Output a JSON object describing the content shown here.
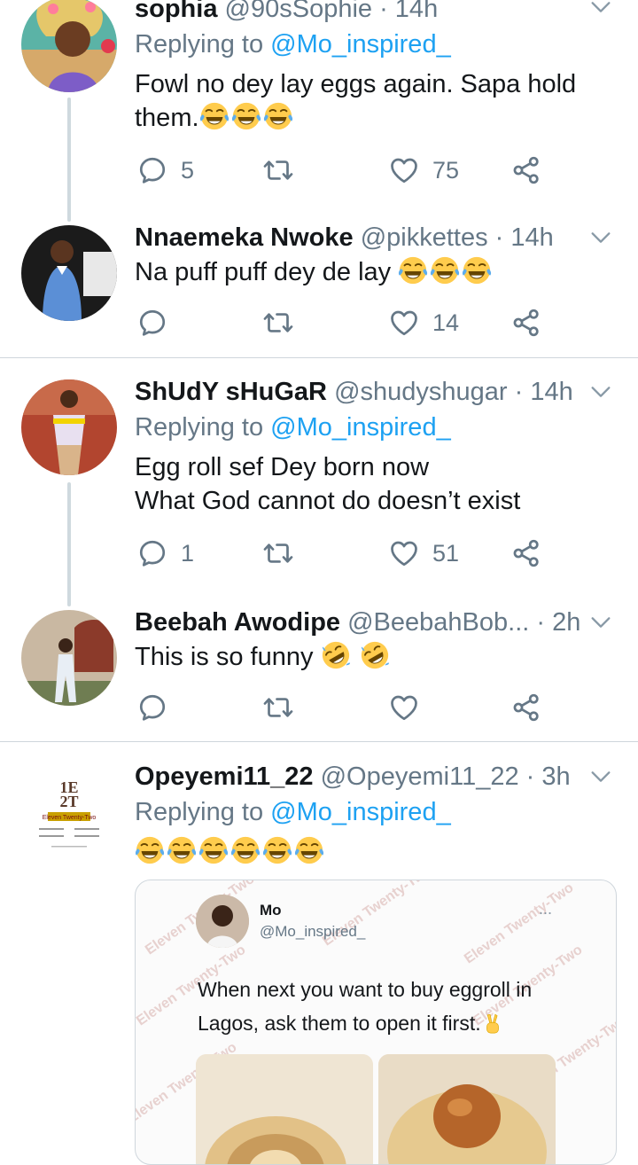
{
  "tweets": [
    {
      "name": "sophia",
      "handle": "@90sSophie",
      "time": "· 14h",
      "replying_prefix": "Replying to ",
      "replying_to": "@Mo_inspired_",
      "text_line1": "Fowl no dey lay eggs again. Sapa hold",
      "text_line2": "them.",
      "replies": "5",
      "likes": "75"
    },
    {
      "name": "Nnaemeka Nwoke",
      "handle": "@pikkettes",
      "time": "· 14h",
      "text_line1": "Na puff puff dey de lay",
      "replies": "",
      "likes": "14"
    },
    {
      "name": "ShUdY sHuGaR",
      "handle": "@shudyshugar",
      "time": "· 14h",
      "replying_prefix": "Replying to ",
      "replying_to": "@Mo_inspired_",
      "text_line1": "Egg roll sef Dey born now",
      "text_line2": "What God cannot do doesn’t exist",
      "replies": "1",
      "likes": "51"
    },
    {
      "name": "Beebah Awodipe",
      "handle": "@BeebahBob...",
      "time": "· 2h",
      "text_line1": "This is so funny",
      "replies": "",
      "likes": ""
    },
    {
      "name": "Opeyemi11_22",
      "handle": "@Opeyemi11_22",
      "time": "· 3h",
      "replying_prefix": "Replying to ",
      "replying_to": "@Mo_inspired_",
      "logo_text_top": "1E",
      "logo_text_bottom": "2T",
      "logo_banner": "Eleven Twenty-Two",
      "quote": {
        "name": "Mo",
        "handle": "@Mo_inspired_",
        "more": "...",
        "text_line1": "When next you want to buy eggroll in",
        "text_line2": "Lagos, ask them to open it first.",
        "watermark": "Eleven Twenty-Two"
      }
    }
  ],
  "colors": {
    "accent": "#1da1f2",
    "secondary_text": "#657786",
    "separator": "#cfd6dc",
    "icon": "#657786"
  },
  "icons": {
    "reply": "reply-icon",
    "retweet": "retweet-icon",
    "like": "heart-icon",
    "share": "share-icon",
    "caret": "chevron-down-icon"
  }
}
